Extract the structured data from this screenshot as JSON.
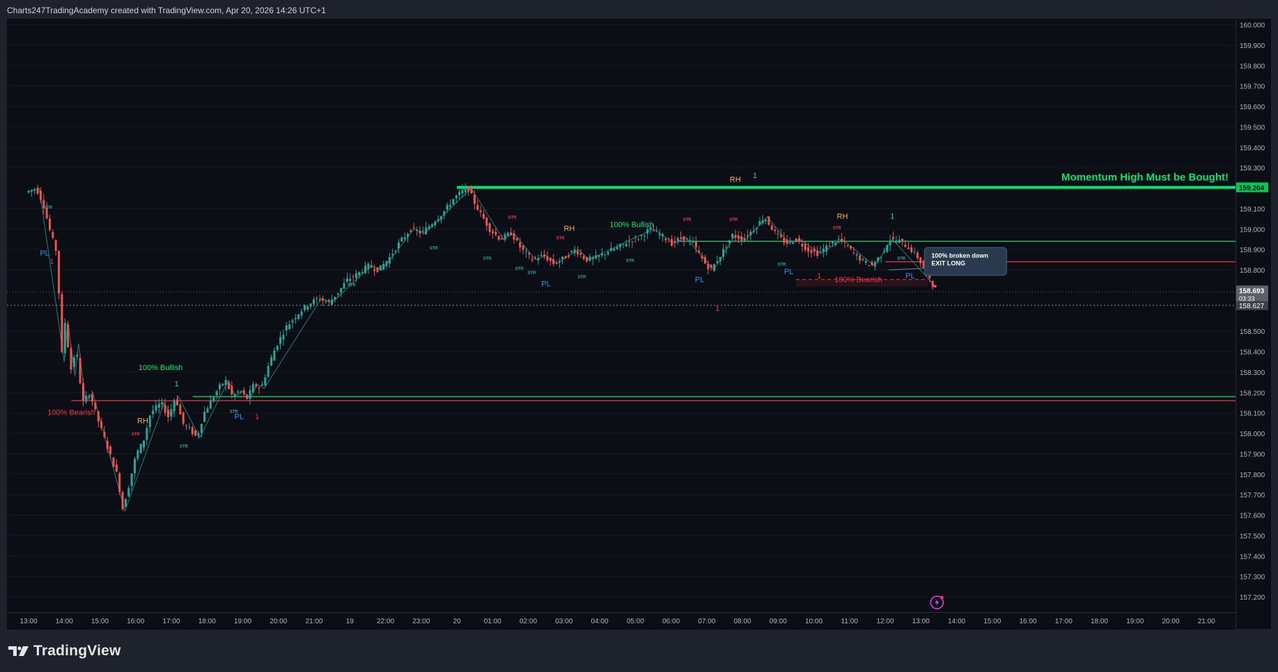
{
  "header": {
    "title": "Charts247TradingAcademy created with TradingView.com, Apr 20, 2026 14:26 UTC+1"
  },
  "footer": {
    "brand": "TradingView",
    "icon": "tradingview-logo-icon"
  },
  "colors": {
    "bull": "#26a69a",
    "bear": "#ef5350",
    "bright_green": "#00e676",
    "red_line": "#f23645",
    "pl": "#2196f3",
    "rh": "#f5b041",
    "background": "#0c0e15"
  },
  "chart_data": {
    "type": "candlestick",
    "title": "",
    "xlabel": "",
    "ylabel": "",
    "ylim": [
      157.1,
      160.05
    ],
    "x_ticks": [
      "13:00",
      "14:00",
      "15:00",
      "16:00",
      "17:00",
      "18:00",
      "19:00",
      "20:00",
      "21:00",
      "19",
      "22:00",
      "23:00",
      "20",
      "01:00",
      "02:00",
      "03:00",
      "04:00",
      "05:00",
      "06:00",
      "07:00",
      "08:00",
      "09:00",
      "10:00",
      "11:00",
      "12:00",
      "13:00",
      "14:00",
      "15:00",
      "16:00",
      "17:00",
      "18:00",
      "19:00",
      "20:00",
      "21:00"
    ],
    "y_ticks": [
      "160.000",
      "159.900",
      "159.800",
      "159.700",
      "159.600",
      "159.500",
      "159.400",
      "159.300",
      "159.100",
      "159.000",
      "158.900",
      "158.800",
      "158.500",
      "158.400",
      "158.300",
      "158.200",
      "158.100",
      "158.000",
      "157.900",
      "157.800",
      "157.700",
      "157.600",
      "157.500",
      "157.400",
      "157.300",
      "157.200"
    ],
    "price_path": [
      [
        13.0,
        159.18
      ],
      [
        13.3,
        159.2
      ],
      [
        13.5,
        159.12
      ],
      [
        13.7,
        158.98
      ],
      [
        13.9,
        158.87
      ],
      [
        14.0,
        158.35
      ],
      [
        14.1,
        158.55
      ],
      [
        14.3,
        158.28
      ],
      [
        14.4,
        158.44
      ],
      [
        14.6,
        158.15
      ],
      [
        14.8,
        158.2
      ],
      [
        15.0,
        158.08
      ],
      [
        15.2,
        157.98
      ],
      [
        15.4,
        157.88
      ],
      [
        15.6,
        157.78
      ],
      [
        15.7,
        157.62
      ],
      [
        15.9,
        157.75
      ],
      [
        16.1,
        157.9
      ],
      [
        16.3,
        157.96
      ],
      [
        16.5,
        158.1
      ],
      [
        16.8,
        158.15
      ],
      [
        17.0,
        158.08
      ],
      [
        17.2,
        158.18
      ],
      [
        17.4,
        158.05
      ],
      [
        17.6,
        158.02
      ],
      [
        17.8,
        157.98
      ],
      [
        18.0,
        158.1
      ],
      [
        18.2,
        158.16
      ],
      [
        18.4,
        158.22
      ],
      [
        18.6,
        158.26
      ],
      [
        18.8,
        158.18
      ],
      [
        19.0,
        158.21
      ],
      [
        19.2,
        158.17
      ],
      [
        19.4,
        158.24
      ],
      [
        19.6,
        158.22
      ],
      [
        19.8,
        158.33
      ],
      [
        20.0,
        158.42
      ],
      [
        20.3,
        158.52
      ],
      [
        20.6,
        158.58
      ],
      [
        20.9,
        158.63
      ],
      [
        21.2,
        158.66
      ],
      [
        21.5,
        158.64
      ],
      [
        21.8,
        158.7
      ],
      [
        22.0,
        158.75
      ],
      [
        22.3,
        158.78
      ],
      [
        22.6,
        158.82
      ],
      [
        22.9,
        158.8
      ],
      [
        23.2,
        158.86
      ],
      [
        23.5,
        158.94
      ],
      [
        23.8,
        159.0
      ],
      [
        24.1,
        158.98
      ],
      [
        24.4,
        159.03
      ],
      [
        24.7,
        159.08
      ],
      [
        25.0,
        159.15
      ],
      [
        25.2,
        159.18
      ],
      [
        25.4,
        159.2
      ],
      [
        25.6,
        159.12
      ],
      [
        25.8,
        159.06
      ],
      [
        26.0,
        159.0
      ],
      [
        26.3,
        158.95
      ],
      [
        26.6,
        158.98
      ],
      [
        26.9,
        158.9
      ],
      [
        27.2,
        158.85
      ],
      [
        27.5,
        158.87
      ],
      [
        27.8,
        158.83
      ],
      [
        28.1,
        158.86
      ],
      [
        28.4,
        158.9
      ],
      [
        28.7,
        158.85
      ],
      [
        29.0,
        158.86
      ],
      [
        29.3,
        158.89
      ],
      [
        29.6,
        158.91
      ],
      [
        29.9,
        158.94
      ],
      [
        30.2,
        158.96
      ],
      [
        30.5,
        159.0
      ],
      [
        30.8,
        158.97
      ],
      [
        31.1,
        158.93
      ],
      [
        31.4,
        158.96
      ],
      [
        31.7,
        158.93
      ],
      [
        32.0,
        158.84
      ],
      [
        32.2,
        158.8
      ],
      [
        32.5,
        158.88
      ],
      [
        32.8,
        158.97
      ],
      [
        33.1,
        158.95
      ],
      [
        33.4,
        159.0
      ],
      [
        33.7,
        159.06
      ],
      [
        34.0,
        158.98
      ],
      [
        34.3,
        158.93
      ],
      [
        34.6,
        158.95
      ],
      [
        34.9,
        158.9
      ],
      [
        35.2,
        158.88
      ],
      [
        35.5,
        158.92
      ],
      [
        35.8,
        158.95
      ],
      [
        36.1,
        158.9
      ],
      [
        36.4,
        158.85
      ],
      [
        36.7,
        158.82
      ],
      [
        37.0,
        158.88
      ],
      [
        37.2,
        158.95
      ],
      [
        37.5,
        158.94
      ],
      [
        37.8,
        158.9
      ],
      [
        38.0,
        158.86
      ],
      [
        38.2,
        158.8
      ],
      [
        38.4,
        158.72
      ]
    ],
    "horizontal_levels": [
      {
        "price": 159.204,
        "color": "#00e676",
        "width": 4,
        "from": 25.0,
        "label": "Momentum High Must be Bought!"
      },
      {
        "price": 158.94,
        "color": "#00e676",
        "width": 1.2,
        "from": 31.2
      },
      {
        "price": 158.84,
        "color": "#f23645",
        "width": 1.2,
        "from": 37.0
      },
      {
        "price": 158.18,
        "color": "#00e676",
        "width": 1.2,
        "from": 17.6
      },
      {
        "price": 158.16,
        "color": "#f23645",
        "width": 1.2,
        "from": 14.2
      },
      {
        "price": 158.753,
        "color": "#f23645",
        "width": 1,
        "from": 34.5,
        "to": 38.2,
        "dashed": true
      }
    ],
    "current_price": {
      "value": "158.693",
      "countdown": "03:33"
    },
    "dotted_price": {
      "value": "158.627"
    },
    "badge_price": "159.204",
    "annotations": [
      {
        "text": "PL",
        "color": "#2196f3",
        "x": 13.45,
        "y": 158.87,
        "size": 11
      },
      {
        "text": "1",
        "color": "#f23645",
        "x": 13.65,
        "y": 158.83,
        "size": 10
      },
      {
        "text": "STR",
        "color": "#26a69a",
        "x": 13.55,
        "y": 159.1,
        "size": 6
      },
      {
        "text": "100% Bearish",
        "color": "#f23645",
        "x": 14.2,
        "y": 158.09,
        "size": 11
      },
      {
        "text": "100% Bullish",
        "color": "#00e676",
        "x": 16.7,
        "y": 158.31,
        "size": 11
      },
      {
        "text": "1",
        "color": "#00e676",
        "x": 17.15,
        "y": 158.23,
        "size": 11
      },
      {
        "text": "RH",
        "color": "#f5b041",
        "x": 16.2,
        "y": 158.05,
        "size": 11
      },
      {
        "text": "STR",
        "color": "#f23645",
        "x": 16.0,
        "y": 157.99,
        "size": 6
      },
      {
        "text": "STR",
        "color": "#26a69a",
        "x": 17.35,
        "y": 157.93,
        "size": 6
      },
      {
        "text": "STR",
        "color": "#26a69a",
        "x": 18.75,
        "y": 158.1,
        "size": 6
      },
      {
        "text": "PL",
        "color": "#2196f3",
        "x": 18.9,
        "y": 158.07,
        "size": 11
      },
      {
        "text": "1",
        "color": "#f23645",
        "x": 19.4,
        "y": 158.07,
        "size": 11
      },
      {
        "text": "STR",
        "color": "#26a69a",
        "x": 22.05,
        "y": 158.72,
        "size": 6
      },
      {
        "text": "STR",
        "color": "#26a69a",
        "x": 24.35,
        "y": 158.9,
        "size": 6
      },
      {
        "text": "STR",
        "color": "#f23645",
        "x": 26.55,
        "y": 159.05,
        "size": 6
      },
      {
        "text": "STR",
        "color": "#26a69a",
        "x": 25.85,
        "y": 158.85,
        "size": 6
      },
      {
        "text": "STR",
        "color": "#26a69a",
        "x": 26.75,
        "y": 158.8,
        "size": 6
      },
      {
        "text": "STR",
        "color": "#26a69a",
        "x": 27.1,
        "y": 158.78,
        "size": 6
      },
      {
        "text": "RH",
        "color": "#f5b041",
        "x": 28.15,
        "y": 158.99,
        "size": 11
      },
      {
        "text": "STR",
        "color": "#f23645",
        "x": 27.9,
        "y": 158.95,
        "size": 6
      },
      {
        "text": "PL",
        "color": "#2196f3",
        "x": 27.5,
        "y": 158.72,
        "size": 11
      },
      {
        "text": "STR",
        "color": "#26a69a",
        "x": 28.5,
        "y": 158.76,
        "size": 6
      },
      {
        "text": "100% Bullish",
        "color": "#00e676",
        "x": 29.9,
        "y": 159.01,
        "size": 11
      },
      {
        "text": "STR",
        "color": "#26a69a",
        "x": 29.85,
        "y": 158.84,
        "size": 6
      },
      {
        "text": "STR",
        "color": "#f23645",
        "x": 31.45,
        "y": 159.04,
        "size": 6
      },
      {
        "text": "PL",
        "color": "#2196f3",
        "x": 31.8,
        "y": 158.74,
        "size": 11
      },
      {
        "text": "1",
        "color": "#f23645",
        "x": 32.3,
        "y": 158.6,
        "size": 11
      },
      {
        "text": "RH",
        "color": "#f5b041",
        "x": 32.8,
        "y": 159.23,
        "size": 11
      },
      {
        "text": "1",
        "color": "#00e676",
        "x": 33.35,
        "y": 159.25,
        "size": 11
      },
      {
        "text": "STR",
        "color": "#f23645",
        "x": 32.75,
        "y": 159.04,
        "size": 6
      },
      {
        "text": "STR",
        "color": "#26a69a",
        "x": 34.1,
        "y": 158.82,
        "size": 6
      },
      {
        "text": "PL",
        "color": "#2196f3",
        "x": 34.3,
        "y": 158.78,
        "size": 11
      },
      {
        "text": "1",
        "color": "#f23645",
        "x": 35.15,
        "y": 158.76,
        "size": 11
      },
      {
        "text": "RH",
        "color": "#f5b041",
        "x": 35.8,
        "y": 159.05,
        "size": 11
      },
      {
        "text": "STR",
        "color": "#f23645",
        "x": 35.65,
        "y": 159.0,
        "size": 6
      },
      {
        "text": "1",
        "color": "#00e676",
        "x": 37.2,
        "y": 159.05,
        "size": 11
      },
      {
        "text": "100% Bearish",
        "color": "#f23645",
        "x": 36.25,
        "y": 158.74,
        "size": 11
      },
      {
        "text": "STR",
        "color": "#26a69a",
        "x": 37.45,
        "y": 158.85,
        "size": 6
      },
      {
        "text": "PL",
        "color": "#2196f3",
        "x": 37.7,
        "y": 158.76,
        "size": 11
      }
    ],
    "callout": {
      "lines": [
        "100% broken down",
        "EXIT LONG"
      ],
      "x": 38.1,
      "y": 158.91
    }
  }
}
